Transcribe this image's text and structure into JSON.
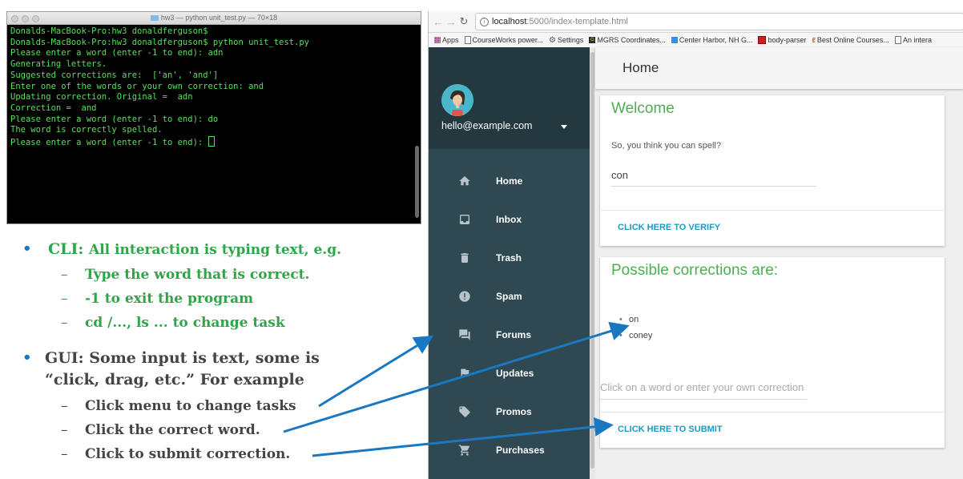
{
  "terminal": {
    "title": "hw3 — python unit_test.py — 70×18",
    "lines": [
      "Donalds-MacBook-Pro:hw3 donaldferguson$",
      "Donalds-MacBook-Pro:hw3 donaldferguson$ python unit_test.py",
      "Please enter a word (enter -1 to end): adn",
      "Generating letters.",
      "Suggested corrections are:  ['an', 'and']",
      "Enter one of the words or your own correction: and",
      "Updating correction. Original =  adn",
      "Correction =  and",
      "Please enter a word (enter -1 to end): do",
      "The word is correctly spelled.",
      "Please enter a word (enter -1 to end): "
    ]
  },
  "bullets": {
    "cli_title": "CLI:",
    "cli_text": "All interaction is typing text, e.g.",
    "cli_items": [
      "Type the word that is correct.",
      "-1 to exit the program",
      "cd /..., ls ... to change task"
    ],
    "gui_line1": "GUI: Some input is text, some is",
    "gui_line2": "“click, drag, etc.” For example",
    "gui_items": [
      "Click menu to change tasks",
      "Click the correct word.",
      "Click to submit correction."
    ],
    "dash": "–",
    "dot": "•"
  },
  "browser": {
    "url_host": "localhost",
    "url_path": ":5000/index-template.html",
    "bookmarks": [
      "Apps",
      "CourseWorks power...",
      "Settings",
      "MGRS Coordinates...",
      "Center Harbor, NH G...",
      "body-parser",
      "Best Online Courses...",
      "An intera"
    ]
  },
  "app": {
    "user_email": "hello@example.com",
    "nav": [
      {
        "label": "Home",
        "icon": "home-icon"
      },
      {
        "label": "Inbox",
        "icon": "inbox-icon"
      },
      {
        "label": "Trash",
        "icon": "trash-icon"
      },
      {
        "label": "Spam",
        "icon": "spam-icon"
      },
      {
        "label": "Forums",
        "icon": "forums-icon"
      },
      {
        "label": "Updates",
        "icon": "updates-icon"
      },
      {
        "label": "Promos",
        "icon": "promos-icon"
      },
      {
        "label": "Purchases",
        "icon": "purchases-icon"
      }
    ],
    "appbar_title": "Home",
    "welcome": {
      "title": "Welcome",
      "prompt": "So, you think you can spell?",
      "input_value": "con",
      "verify_label": "CLICK HERE TO VERIFY"
    },
    "corrections": {
      "title": "Possible corrections are:",
      "items": [
        "on",
        "coney"
      ],
      "input_placeholder": "Click on a word or enter your own correction",
      "submit_label": "CLICK HERE TO SUBMIT"
    }
  },
  "colors": {
    "terminal_text": "#57e05a",
    "cli_green": "#2fa547",
    "arrow_blue": "#1a78c2",
    "card_title_green": "#4caf50",
    "button_cyan": "#1c9bbf",
    "sidebar_dark": "#243840",
    "sidebar_nav": "#2f4952"
  }
}
